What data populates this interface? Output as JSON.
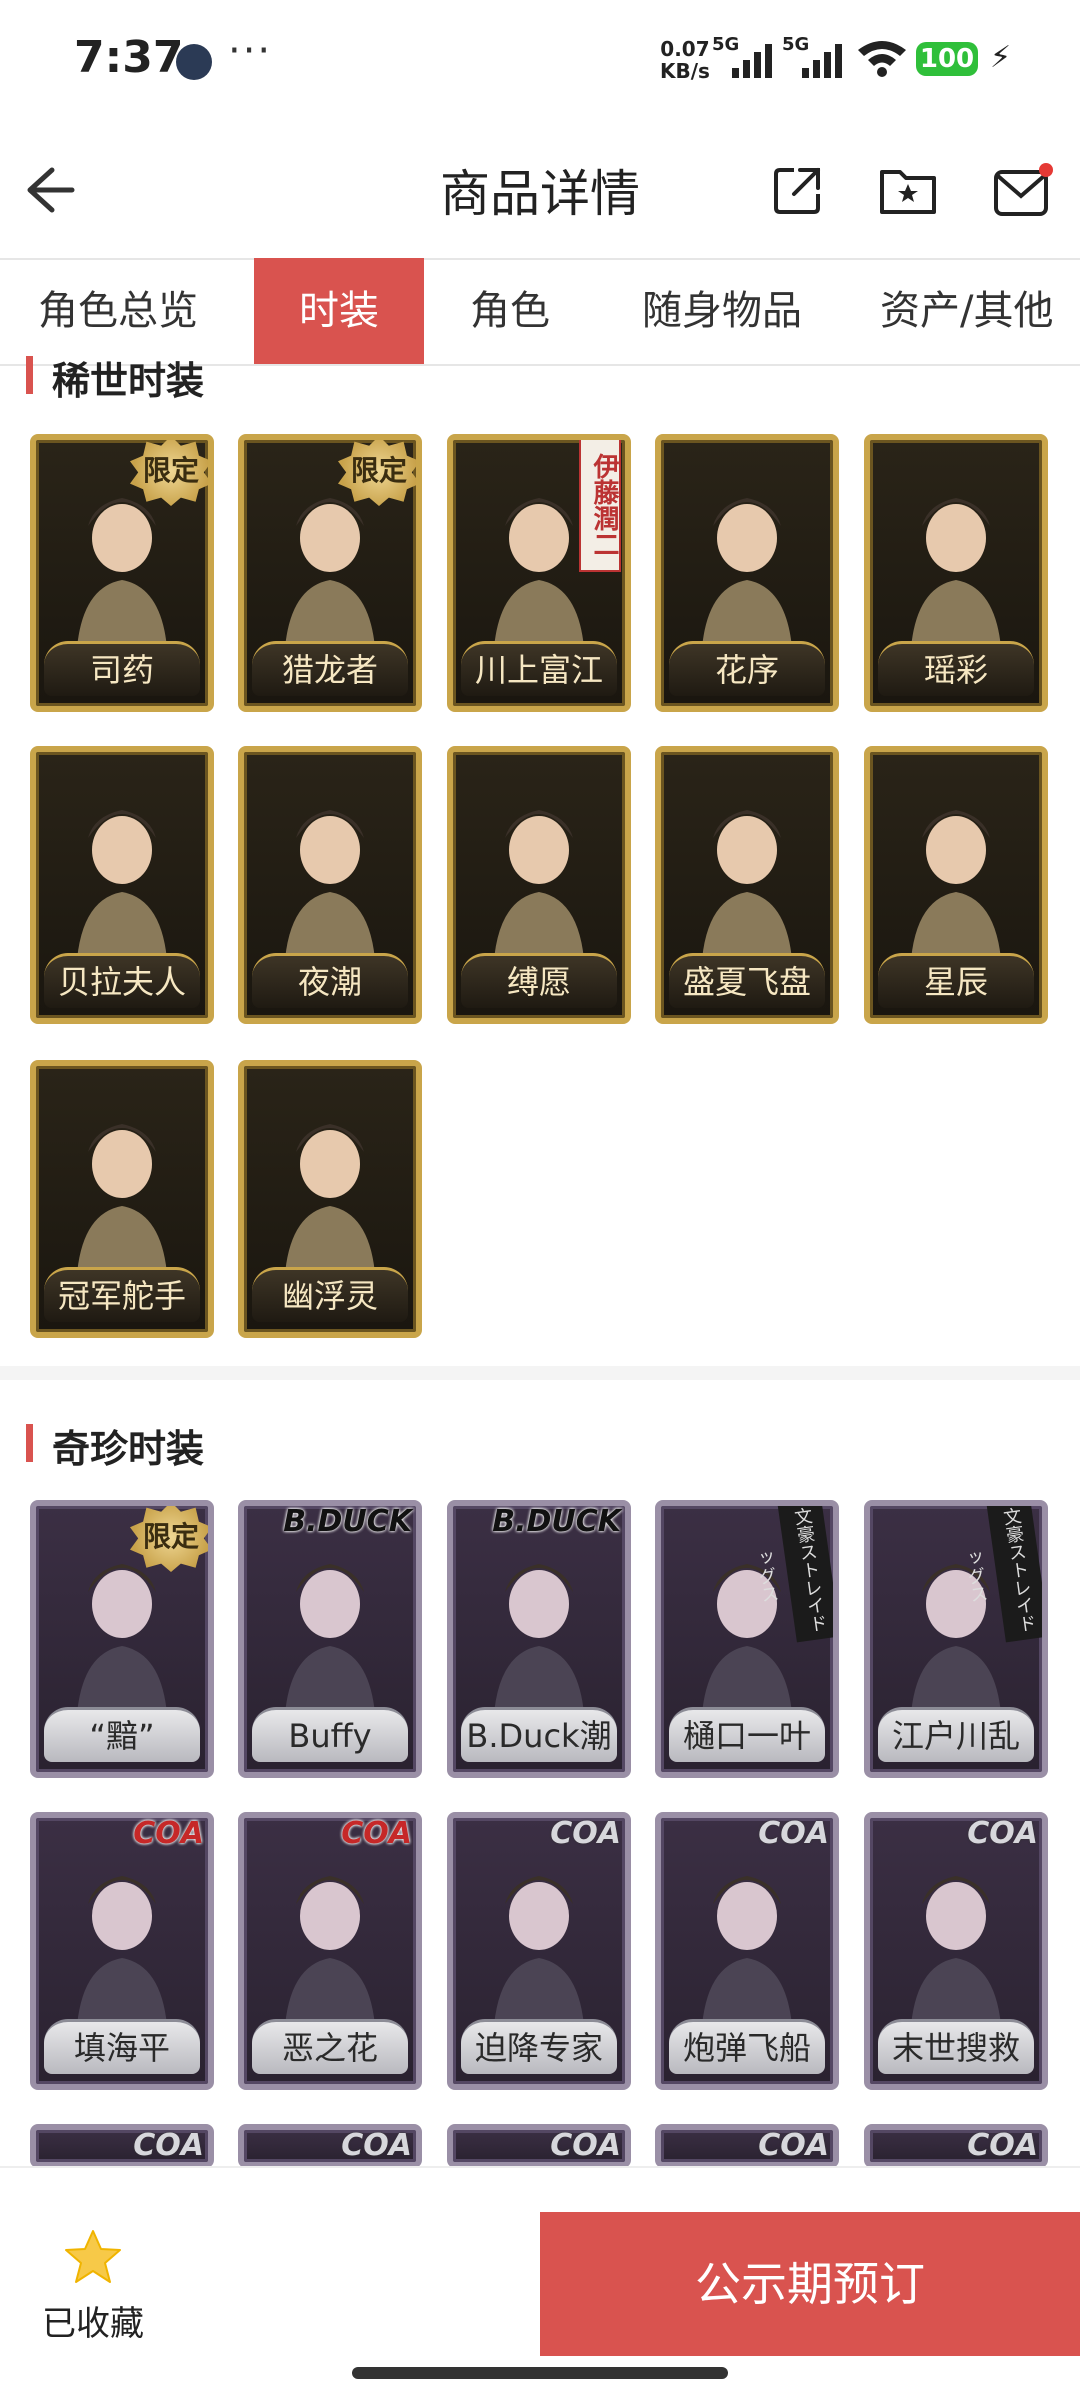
{
  "status": {
    "time": "7:37",
    "net_speed": "0.07",
    "net_unit": "KB/s",
    "signal1": "5G",
    "signal2": "5G",
    "battery": "100"
  },
  "header": {
    "title": "商品详情"
  },
  "tabs": [
    {
      "label": "角色总览",
      "active": false
    },
    {
      "label": "时装",
      "active": true
    },
    {
      "label": "角色",
      "active": false
    },
    {
      "label": "随身物品",
      "active": false
    },
    {
      "label": "资产/其他"
    }
  ],
  "sections": {
    "rare": {
      "title": "稀世时装",
      "items": [
        "司药",
        "猎龙者",
        "川上富江",
        "花序",
        "瑶彩",
        "贝拉夫人",
        "夜潮",
        "缚愿",
        "盛夏飞盘",
        "星辰",
        "冠军舵手",
        "幽浮灵"
      ],
      "badges": {
        "limited": "限定",
        "collab_vertical": "伊藤潤二"
      }
    },
    "exotic": {
      "title": "奇珍时装",
      "items": [
        "“黯”",
        "Buffy",
        "B.Duck潮",
        "樋口一叶",
        "江户川乱步",
        "填海平",
        "恶之花",
        "迫降专家",
        "炮弹飞船",
        "末世搜救"
      ],
      "badges": {
        "limited": "限定",
        "bduck": "B.DUCK",
        "coa": "COA",
        "bungo": "文豪ストレイドッグス"
      }
    }
  },
  "bottom": {
    "favorite_label": "已收藏",
    "cta_label": "公示期预订"
  },
  "colors": {
    "accent": "#d9534f",
    "gold_frame": "#c9a54a",
    "purple_frame": "#9a8fa6"
  }
}
